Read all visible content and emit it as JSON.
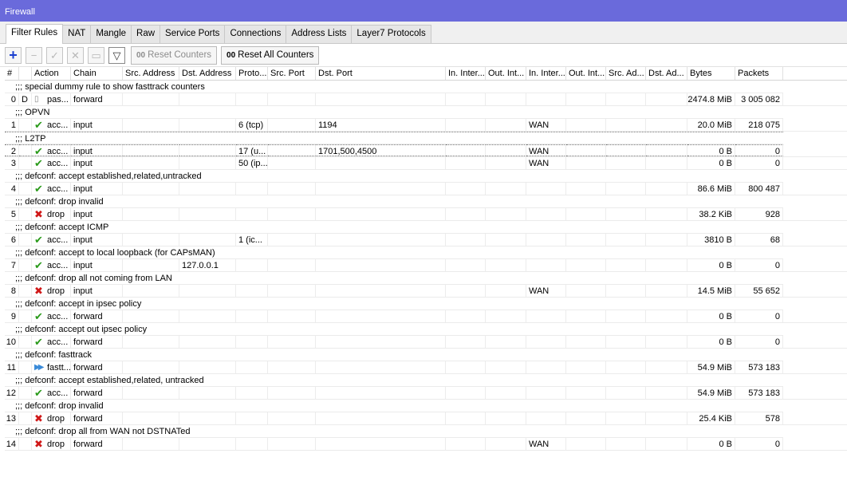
{
  "window": {
    "title": "Firewall"
  },
  "tabs": [
    "Filter Rules",
    "NAT",
    "Mangle",
    "Raw",
    "Service Ports",
    "Connections",
    "Address Lists",
    "Layer7 Protocols"
  ],
  "toolbar": {
    "plus_icon": "+",
    "minus_icon": "−",
    "check_icon": "✓",
    "cross_icon": "✕",
    "comment_icon": "▭",
    "filter_icon": "▽",
    "reset_counters": "Reset Counters",
    "reset_all_counters": "Reset All Counters",
    "oo": "00"
  },
  "columns": [
    "#",
    "",
    "Action",
    "Chain",
    "Src. Address",
    "Dst. Address",
    "Proto...",
    "Src. Port",
    "Dst. Port",
    "In. Inter...",
    "Out. Int...",
    "In. Inter...",
    "Out. Int...",
    "Src. Ad...",
    "Dst. Ad...",
    "Bytes",
    "Packets"
  ],
  "rows": [
    {
      "comment": ";;; special dummy rule to show fasttrack counters",
      "num": "0",
      "flag": "D",
      "icon": "pas",
      "icon_glyph": "▯",
      "action": "pas...",
      "chain": "forward",
      "src": "",
      "dst": "",
      "proto": "",
      "sport": "",
      "dport": "",
      "inif": "",
      "outif": "",
      "inlist": "",
      "outlist": "",
      "srcl": "",
      "dstl": "",
      "bytes": "2474.8 MiB",
      "packets": "3 005 082"
    },
    {
      "comment": ";;; OPVN",
      "num": "1",
      "flag": "",
      "icon": "acc",
      "icon_glyph": "✔",
      "action": "acc...",
      "chain": "input",
      "src": "",
      "dst": "",
      "proto": "6 (tcp)",
      "sport": "",
      "dport": "1194",
      "inif": "",
      "outif": "",
      "inlist": "WAN",
      "outlist": "",
      "srcl": "",
      "dstl": "",
      "bytes": "20.0 MiB",
      "packets": "218 075"
    },
    {
      "comment": ";;; L2TP",
      "num": "2",
      "flag": "",
      "icon": "acc",
      "icon_glyph": "✔",
      "action": "acc...",
      "chain": "input",
      "src": "",
      "dst": "",
      "proto": "17 (u...",
      "sport": "",
      "dport": "1701,500,4500",
      "inif": "",
      "outif": "",
      "inlist": "WAN",
      "outlist": "",
      "srcl": "",
      "dstl": "",
      "bytes": "0 B",
      "packets": "0",
      "selected": true
    },
    {
      "comment": null,
      "num": "3",
      "flag": "",
      "icon": "acc",
      "icon_glyph": "✔",
      "action": "acc...",
      "chain": "input",
      "src": "",
      "dst": "",
      "proto": "50 (ip...",
      "sport": "",
      "dport": "",
      "inif": "",
      "outif": "",
      "inlist": "WAN",
      "outlist": "",
      "srcl": "",
      "dstl": "",
      "bytes": "0 B",
      "packets": "0"
    },
    {
      "comment": ";;; defconf: accept established,related,untracked",
      "num": "4",
      "flag": "",
      "icon": "acc",
      "icon_glyph": "✔",
      "action": "acc...",
      "chain": "input",
      "src": "",
      "dst": "",
      "proto": "",
      "sport": "",
      "dport": "",
      "inif": "",
      "outif": "",
      "inlist": "",
      "outlist": "",
      "srcl": "",
      "dstl": "",
      "bytes": "86.6 MiB",
      "packets": "800 487"
    },
    {
      "comment": ";;; defconf: drop invalid",
      "num": "5",
      "flag": "",
      "icon": "drop",
      "icon_glyph": "✖",
      "action": "drop",
      "chain": "input",
      "src": "",
      "dst": "",
      "proto": "",
      "sport": "",
      "dport": "",
      "inif": "",
      "outif": "",
      "inlist": "",
      "outlist": "",
      "srcl": "",
      "dstl": "",
      "bytes": "38.2 KiB",
      "packets": "928"
    },
    {
      "comment": ";;; defconf: accept ICMP",
      "num": "6",
      "flag": "",
      "icon": "acc",
      "icon_glyph": "✔",
      "action": "acc...",
      "chain": "input",
      "src": "",
      "dst": "",
      "proto": "1 (ic...",
      "sport": "",
      "dport": "",
      "inif": "",
      "outif": "",
      "inlist": "",
      "outlist": "",
      "srcl": "",
      "dstl": "",
      "bytes": "3810 B",
      "packets": "68"
    },
    {
      "comment": ";;; defconf: accept to local loopback (for CAPsMAN)",
      "num": "7",
      "flag": "",
      "icon": "acc",
      "icon_glyph": "✔",
      "action": "acc...",
      "chain": "input",
      "src": "",
      "dst": "127.0.0.1",
      "proto": "",
      "sport": "",
      "dport": "",
      "inif": "",
      "outif": "",
      "inlist": "",
      "outlist": "",
      "srcl": "",
      "dstl": "",
      "bytes": "0 B",
      "packets": "0"
    },
    {
      "comment": ";;; defconf: drop all not coming from LAN",
      "num": "8",
      "flag": "",
      "icon": "drop",
      "icon_glyph": "✖",
      "action": "drop",
      "chain": "input",
      "src": "",
      "dst": "",
      "proto": "",
      "sport": "",
      "dport": "",
      "inif": "",
      "outif": "",
      "inlist": "WAN",
      "outlist": "",
      "srcl": "",
      "dstl": "",
      "bytes": "14.5 MiB",
      "packets": "55 652"
    },
    {
      "comment": ";;; defconf: accept in ipsec policy",
      "num": "9",
      "flag": "",
      "icon": "acc",
      "icon_glyph": "✔",
      "action": "acc...",
      "chain": "forward",
      "src": "",
      "dst": "",
      "proto": "",
      "sport": "",
      "dport": "",
      "inif": "",
      "outif": "",
      "inlist": "",
      "outlist": "",
      "srcl": "",
      "dstl": "",
      "bytes": "0 B",
      "packets": "0"
    },
    {
      "comment": ";;; defconf: accept out ipsec policy",
      "num": "10",
      "flag": "",
      "icon": "acc",
      "icon_glyph": "✔",
      "action": "acc...",
      "chain": "forward",
      "src": "",
      "dst": "",
      "proto": "",
      "sport": "",
      "dport": "",
      "inif": "",
      "outif": "",
      "inlist": "",
      "outlist": "",
      "srcl": "",
      "dstl": "",
      "bytes": "0 B",
      "packets": "0"
    },
    {
      "comment": ";;; defconf: fasttrack",
      "num": "11",
      "flag": "",
      "icon": "ft",
      "icon_glyph": "▶▶",
      "action": "fastt...",
      "chain": "forward",
      "src": "",
      "dst": "",
      "proto": "",
      "sport": "",
      "dport": "",
      "inif": "",
      "outif": "",
      "inlist": "",
      "outlist": "",
      "srcl": "",
      "dstl": "",
      "bytes": "54.9 MiB",
      "packets": "573 183"
    },
    {
      "comment": ";;; defconf: accept established,related, untracked",
      "num": "12",
      "flag": "",
      "icon": "acc",
      "icon_glyph": "✔",
      "action": "acc...",
      "chain": "forward",
      "src": "",
      "dst": "",
      "proto": "",
      "sport": "",
      "dport": "",
      "inif": "",
      "outif": "",
      "inlist": "",
      "outlist": "",
      "srcl": "",
      "dstl": "",
      "bytes": "54.9 MiB",
      "packets": "573 183"
    },
    {
      "comment": ";;; defconf: drop invalid",
      "num": "13",
      "flag": "",
      "icon": "drop",
      "icon_glyph": "✖",
      "action": "drop",
      "chain": "forward",
      "src": "",
      "dst": "",
      "proto": "",
      "sport": "",
      "dport": "",
      "inif": "",
      "outif": "",
      "inlist": "",
      "outlist": "",
      "srcl": "",
      "dstl": "",
      "bytes": "25.4 KiB",
      "packets": "578"
    },
    {
      "comment": ";;; defconf: drop all from WAN not DSTNATed",
      "num": "14",
      "flag": "",
      "icon": "drop",
      "icon_glyph": "✖",
      "action": "drop",
      "chain": "forward",
      "src": "",
      "dst": "",
      "proto": "",
      "sport": "",
      "dport": "",
      "inif": "",
      "outif": "",
      "inlist": "WAN",
      "outlist": "",
      "srcl": "",
      "dstl": "",
      "bytes": "0 B",
      "packets": "0"
    }
  ]
}
